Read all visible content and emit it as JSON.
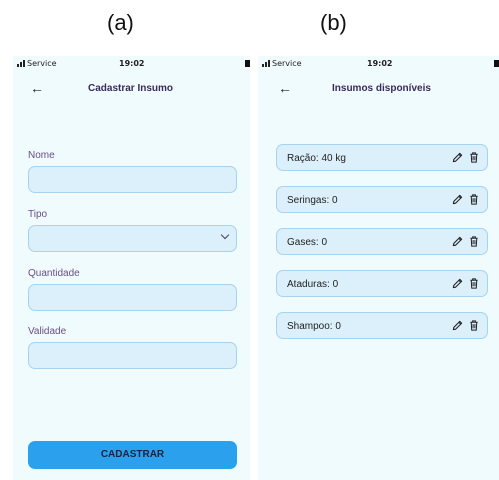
{
  "captions": {
    "a": "(a)",
    "b": "(b)"
  },
  "status_bar": {
    "carrier": "Service",
    "time": "19:02"
  },
  "screen_a": {
    "title": "Cadastrar Insumo",
    "fields": [
      {
        "label": "Nome",
        "value": "",
        "type": "text"
      },
      {
        "label": "Tipo",
        "value": "",
        "type": "select"
      },
      {
        "label": "Quantidade",
        "value": "",
        "type": "text"
      },
      {
        "label": "Validade",
        "value": "",
        "type": "text"
      }
    ],
    "submit_label": "CADASTRAR"
  },
  "screen_b": {
    "title": "Insumos disponíveis",
    "items": [
      {
        "text": "Ração: 40 kg"
      },
      {
        "text": "Seringas: 0"
      },
      {
        "text": "Gases: 0"
      },
      {
        "text": "Ataduras: 0"
      },
      {
        "text": "Shampoo: 0"
      }
    ],
    "item_icons": [
      "pencil-icon",
      "trash-icon"
    ]
  },
  "colors": {
    "screen_bg": "#f0fbfd",
    "field_bg": "#dcf0fb",
    "field_border": "#a6d3ee",
    "label": "#6a4f86",
    "title": "#3a2a5a",
    "button": "#2ba1ee"
  }
}
